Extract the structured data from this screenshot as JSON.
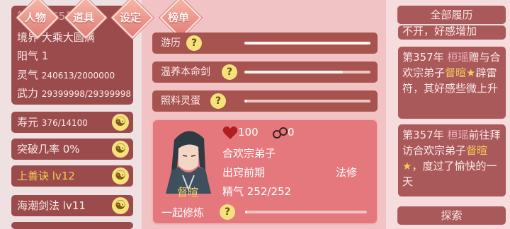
{
  "nav": {
    "character": "人物",
    "items": "道具",
    "settings": "设定",
    "ranking": "榜单"
  },
  "stats": {
    "date_faded": "第357年5月2日",
    "realm": "境界 大乘大圆满",
    "yang": "阳气 1",
    "lingqi_label": "灵气",
    "lingqi_value": "240613/2000000",
    "wuli_label": "武力",
    "wuli_value": "29399998/29399998"
  },
  "left_rows": [
    {
      "label": "寿元",
      "value": "376/14100"
    },
    {
      "label": "突破几率 0%",
      "value": ""
    },
    {
      "label": "上善诀 lv12",
      "value": ""
    },
    {
      "label": "海潮剑法 lv11",
      "value": ""
    }
  ],
  "activities": [
    {
      "label": "游历",
      "progress": 1.0
    },
    {
      "label": "温养本命剑",
      "progress": 0.78
    },
    {
      "label": "照料灵蛋",
      "progress": 0.02
    }
  ],
  "character": {
    "name": "督暄",
    "affection": "100",
    "bond": "0",
    "sect": "合欢宗弟子",
    "stage": "出窍前期",
    "profession": "法修",
    "jingqi": "精气 252/252",
    "train_label": "一起修炼",
    "train_progress": 0.02
  },
  "history": {
    "title": "全部履历",
    "cut_text": "不开，好感增加",
    "entry1": {
      "year": "第357年",
      "actor": "桓瑶",
      "t1": "赠与合欢宗弟子",
      "target": "督暄★",
      "t2": "辟雷符，其好感些微上升"
    },
    "entry2": {
      "year": "第357年",
      "actor": "桓瑶",
      "t1": "前往拜访合欢宗弟子",
      "target": "督暄★",
      "t2": "，度过了愉快的一天"
    },
    "explore": "探索"
  },
  "colors": {
    "accent_gold": "#f2cc56",
    "card_dark": "#9b4b4c",
    "char_card": "#e5787d",
    "highlight_pink": "#f2b0bb"
  },
  "icons": {
    "yinyang": "yin-yang-icon",
    "help": "question-icon",
    "heart": "heart-icon",
    "bond": "link-icon"
  }
}
